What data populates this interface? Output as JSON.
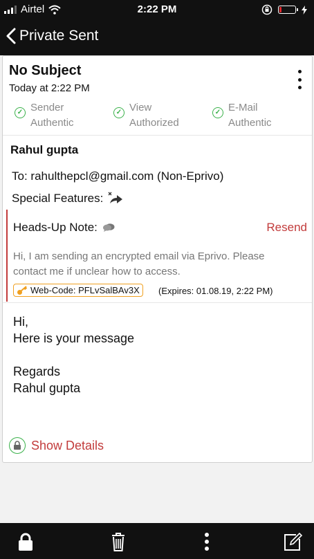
{
  "status_bar": {
    "carrier": "Airtel",
    "time": "2:22 PM",
    "battery_level": 0.12,
    "battery_color": "#e0262b"
  },
  "nav": {
    "back_label": "Private Sent"
  },
  "message": {
    "subject": "No Subject",
    "date": "Today at 2:22 PM",
    "auth": [
      {
        "line1": "Sender",
        "line2": "Authentic"
      },
      {
        "line1": "View",
        "line2": "Authorized"
      },
      {
        "line1": "E-Mail",
        "line2": "Authentic"
      }
    ],
    "sender": "Rahul gupta",
    "to_label": "To:",
    "to_value": "rahulthepcl@gmail.com (Non-Eprivo)",
    "features_label": "Special Features:",
    "note": {
      "label": "Heads-Up Note:",
      "resend": "Resend",
      "text": "Hi, I am sending an encrypted email via Eprivo. Please contact me if unclear how to access.",
      "webcode": "Web-Code: PFLvSalBAv3X",
      "expires": "(Expires: 01.08.19, 2:22 PM)"
    },
    "body": [
      "Hi,",
      "Here is your message",
      "",
      "Regards",
      "Rahul gupta"
    ],
    "show_details": "Show Details"
  },
  "colors": {
    "accent_red": "#c23b3b",
    "check_green": "#3ab14a",
    "webcode_border": "#f0a020",
    "bar_bg": "#111111"
  },
  "icons": [
    "wifi-icon",
    "orientation-lock-icon",
    "charging-icon",
    "chevron-left-icon",
    "kebab-menu-icon",
    "check-circle-icon",
    "forward-arrow-icon",
    "speech-bubble-icon",
    "key-icon",
    "lock-icon",
    "trash-icon",
    "more-vertical-icon",
    "compose-icon"
  ]
}
